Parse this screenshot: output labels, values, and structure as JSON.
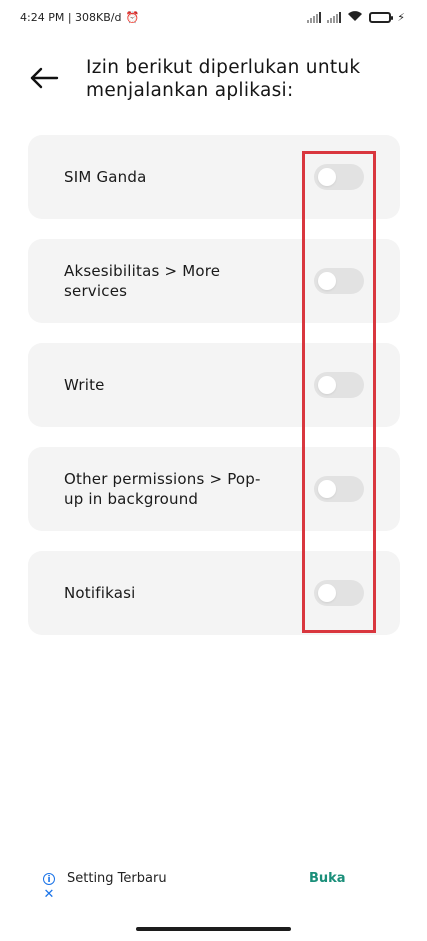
{
  "status_bar": {
    "time_and_speed": "4:24 PM | 308KB/d"
  },
  "header": {
    "title": "Izin berikut diperlukan untuk menjalankan aplikasi:"
  },
  "permissions": [
    {
      "label": "SIM Ganda",
      "enabled": false
    },
    {
      "label": "Aksesibilitas > More services",
      "enabled": false
    },
    {
      "label": "Write",
      "enabled": false
    },
    {
      "label": "Other permissions > Pop-up in background",
      "enabled": false
    },
    {
      "label": "Notifikasi",
      "enabled": false
    }
  ],
  "ad": {
    "title": "Setting Terbaru",
    "action_label": "Buka",
    "action_color": "#1b8f7a",
    "icon_color": "#1a73e8"
  },
  "colors": {
    "card_background": "#f4f4f4",
    "toggle_off": "#e2e2e2",
    "highlight": "#d9363e"
  }
}
